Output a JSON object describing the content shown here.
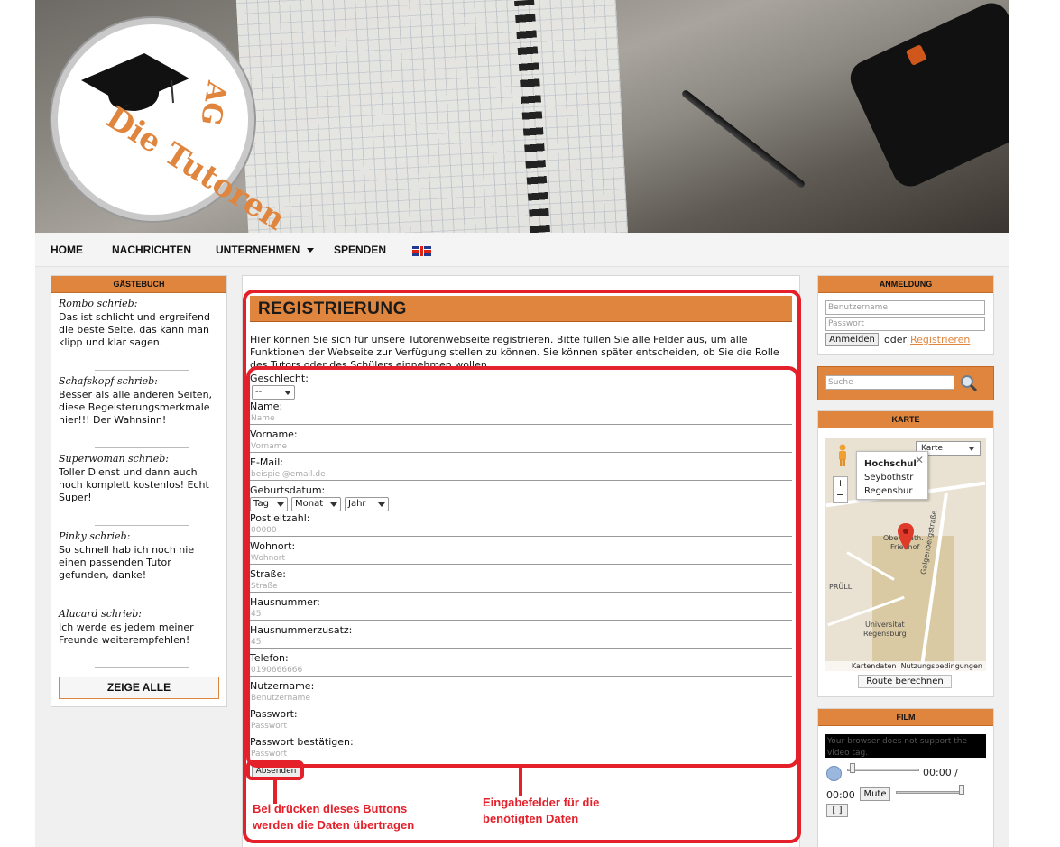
{
  "nav": {
    "home": "HOME",
    "news": "NACHRICHTEN",
    "company": "UNTERNEHMEN",
    "donate": "SPENDEN"
  },
  "logo": {
    "text_a": "Die Tutoren",
    "text_b": "AG"
  },
  "guestbook": {
    "title": "GÄSTEBUCH",
    "entries": [
      {
        "author": "Rombo schrieb:",
        "text": "Das ist schlicht und ergreifend die beste Seite, das kann man klipp und klar sagen."
      },
      {
        "author": "Schafskopf schrieb:",
        "text": "Besser als alle anderen Seiten, diese Begeisterungsmerkmale hier!!! Der Wahnsinn!"
      },
      {
        "author": "Superwoman schrieb:",
        "text": "Toller Dienst und dann auch noch komplett kostenlos! Echt Super!"
      },
      {
        "author": "Pinky schrieb:",
        "text": "So schnell hab ich noch nie einen passenden Tutor gefunden, danke!"
      },
      {
        "author": "Alucard schrieb:",
        "text": "Ich werde es jedem meiner Freunde weiterempfehlen!"
      }
    ],
    "show_all": "ZEIGE ALLE"
  },
  "registration": {
    "title": "REGISTRIERUNG",
    "intro": "Hier können Sie sich für unsere Tutorenwebseite registrieren. Bitte füllen Sie alle Felder aus, um alle Funktionen der Webseite zur Verfügung stellen zu können. Sie können später entscheiden, ob Sie die Rolle des Tutors oder des Schülers einnehmen wollen.",
    "gender_label": "Geschlecht:",
    "gender_value": "--",
    "name_label": "Name:",
    "name_placeholder": "Name",
    "firstname_label": "Vorname:",
    "firstname_placeholder": "Vorname",
    "email_label": "E-Mail:",
    "email_placeholder": "beispiel@email.de",
    "birthdate_label": "Geburtsdatum:",
    "day": "Tag",
    "month": "Monat",
    "year": "Jahr",
    "zip_label": "Postleitzahl:",
    "zip_placeholder": "00000",
    "city_label": "Wohnort:",
    "city_placeholder": "Wohnort",
    "street_label": "Straße:",
    "street_placeholder": "Straße",
    "houseno_label": "Hausnummer:",
    "houseno_placeholder": "45",
    "housenoadd_label": "Hausnummerzusatz:",
    "housenoadd_placeholder": "45",
    "phone_label": "Telefon:",
    "phone_placeholder": "0190666666",
    "username_label": "Nutzername:",
    "username_placeholder": "Benutzername",
    "password_label": "Passwort:",
    "password_placeholder": "Passwort",
    "password2_label": "Passwort bestätigen:",
    "password2_placeholder": "Passwort",
    "submit": "Absenden"
  },
  "annotations": {
    "button_note_1": "Bei drücken dieses Buttons",
    "button_note_2": "werden die Daten übertragen",
    "fields_note_1": "Eingabefelder für die",
    "fields_note_2": "benötigten Daten",
    "color": "#e4202a"
  },
  "login": {
    "title": "ANMELDUNG",
    "user_placeholder": "Benutzername",
    "pass_placeholder": "Passwort",
    "login_button": "Anmelden",
    "or": "oder",
    "register_link": "Registrieren"
  },
  "search": {
    "placeholder": "Suche"
  },
  "map": {
    "title": "KARTE",
    "type": "Karte",
    "popup_title": "Hochschul",
    "popup_line1": "Seybothstr",
    "popup_line2": "Regensbur",
    "label_cemetery_1": "Ober. Kath.",
    "label_cemetery_2": "Friedhof",
    "label_uni_1": "Universitat",
    "label_uni_2": "Regensburg",
    "label_street": "Galgenbergstraße",
    "label_prull": "PRÜLL",
    "attribution_1": "Kartendaten",
    "attribution_2": "Nutzungsbedingungen",
    "route_button": "Route berechnen"
  },
  "film": {
    "title": "FILM",
    "fallback": "Your browser does not support the video tag.",
    "time": "00:00 /",
    "duration": "00:00",
    "mute": "Mute",
    "fullscreen": "[ ]"
  },
  "colors": {
    "accent": "#e0853d",
    "annotation": "#e4202a"
  }
}
